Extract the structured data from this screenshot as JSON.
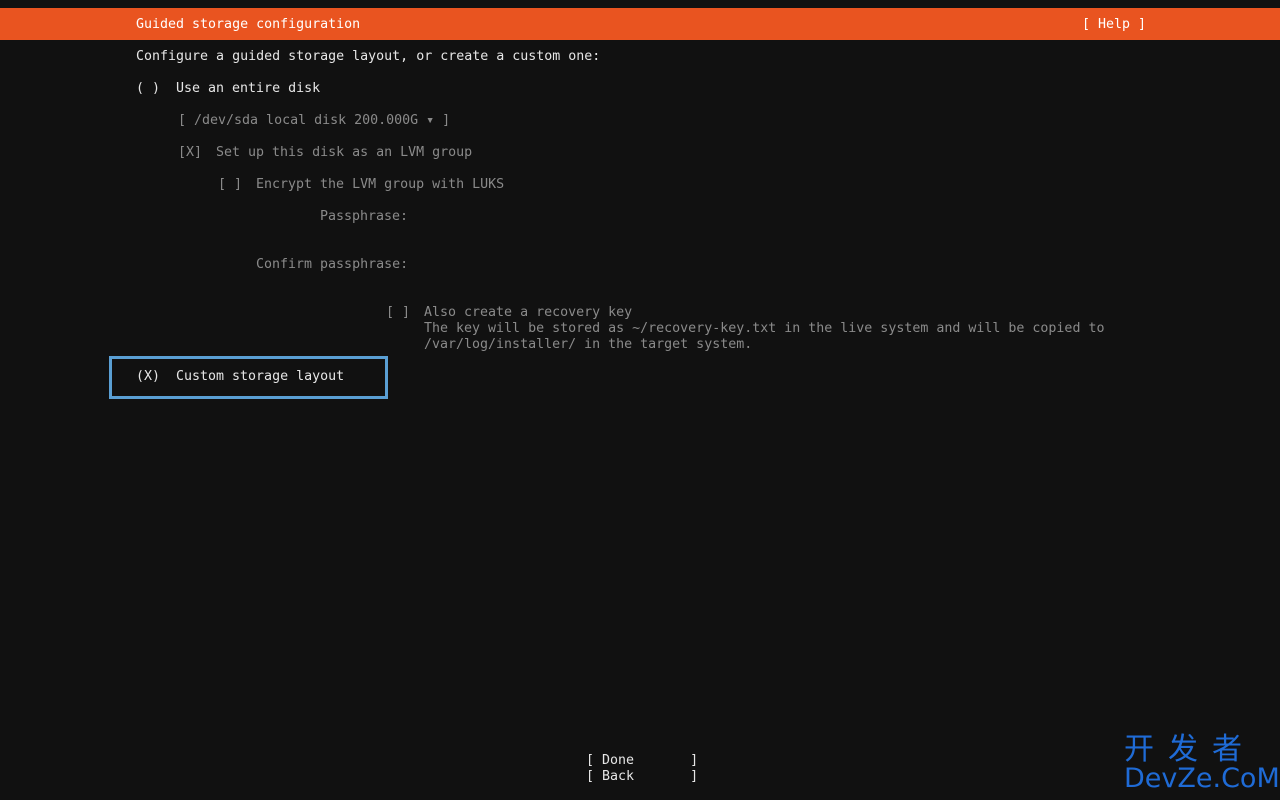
{
  "header": {
    "title": "Guided storage configuration",
    "help_label": "[ Help ]",
    "color": "#e95420"
  },
  "intro": "Configure a guided storage layout, or create a custom one:",
  "options": {
    "entire_disk": {
      "radio": "( )",
      "label": "Use an entire disk",
      "disk_select": "[ /dev/sda local disk 200.000G ▾ ]",
      "lvm": {
        "checkbox": "[X]",
        "label": "Set up this disk as an LVM group"
      },
      "encrypt": {
        "checkbox": "[ ]",
        "label": "Encrypt the LVM group with LUKS"
      },
      "passphrase_label": "Passphrase:",
      "confirm_label": "Confirm passphrase:",
      "recovery": {
        "checkbox": "[ ]",
        "label": "Also create a recovery key",
        "desc_line1": "The key will be stored as ~/recovery-key.txt in the live system and will be copied to",
        "desc_line2": "/var/log/installer/ in the target system."
      }
    },
    "custom": {
      "radio": "(X)",
      "label": "Custom storage layout"
    }
  },
  "buttons": {
    "done": "[ Done       ]",
    "back": "[ Back       ]"
  },
  "watermark": {
    "cn": "开发者",
    "en": "DevZe.CoM"
  },
  "colors": {
    "background": "#111111",
    "focus_border": "#5a9fd4",
    "disabled_text": "#8a8a8a"
  }
}
